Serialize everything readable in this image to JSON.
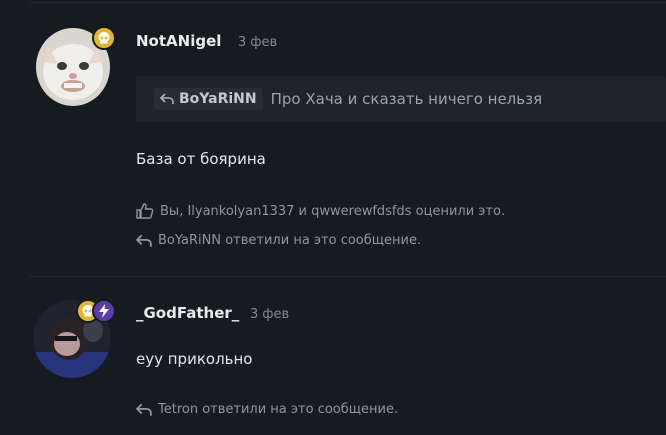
{
  "posts": [
    {
      "author": "NotANigel",
      "date": "3 фев",
      "quote": {
        "author": "BoYaRiNN",
        "text": "Про Хача и сказать ничего нельзя"
      },
      "body": "База от боярина",
      "likes": "Вы, Ilyankolyan1337 и qwwerewfdsfds оценили это.",
      "replies": "BoYaRiNN ответили на это сообщение."
    },
    {
      "author": "_GodFather_",
      "date": "3 фев",
      "body": "еуу прикольно",
      "replies": "Tetron ответили на это сообщение."
    }
  ],
  "colors": {
    "badge_gold": "#e3b531",
    "badge_purple": "#5a3ea8",
    "background": "#161b1f"
  }
}
